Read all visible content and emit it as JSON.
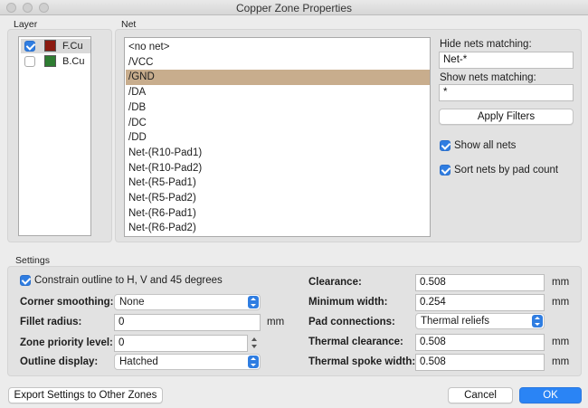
{
  "window": {
    "title": "Copper Zone Properties"
  },
  "layer": {
    "heading": "Layer",
    "items": [
      {
        "label": "F.Cu",
        "checked": true,
        "color": "#8b1a10"
      },
      {
        "label": "B.Cu",
        "checked": false,
        "color": "#2e7d32"
      }
    ]
  },
  "net": {
    "heading": "Net",
    "items": [
      "<no net>",
      "/VCC",
      "/GND",
      "/DA",
      "/DB",
      "/DC",
      "/DD",
      "Net-(R10-Pad1)",
      "Net-(R10-Pad2)",
      "Net-(R5-Pad1)",
      "Net-(R5-Pad2)",
      "Net-(R6-Pad1)",
      "Net-(R6-Pad2)"
    ],
    "selected": "/GND"
  },
  "filters": {
    "hide_label": "Hide nets matching:",
    "hide_value": "Net-*",
    "show_label": "Show nets matching:",
    "show_value": "*",
    "apply_label": "Apply Filters",
    "show_all_label": "Show all nets",
    "sort_label": "Sort nets by pad count"
  },
  "settings": {
    "heading": "Settings",
    "constrain_label": "Constrain outline to H, V and 45 degrees",
    "corner_smoothing_label": "Corner smoothing:",
    "corner_smoothing_value": "None",
    "fillet_radius_label": "Fillet radius:",
    "fillet_radius_value": "0",
    "fillet_radius_unit": "mm",
    "priority_label": "Zone priority level:",
    "priority_value": "0",
    "outline_display_label": "Outline display:",
    "outline_display_value": "Hatched",
    "clearance_label": "Clearance:",
    "clearance_value": "0.508",
    "clearance_unit": "mm",
    "min_width_label": "Minimum width:",
    "min_width_value": "0.254",
    "min_width_unit": "mm",
    "pad_connections_label": "Pad connections:",
    "pad_connections_value": "Thermal reliefs",
    "thermal_clearance_label": "Thermal clearance:",
    "thermal_clearance_value": "0.508",
    "thermal_clearance_unit": "mm",
    "spoke_width_label": "Thermal spoke width:",
    "spoke_width_value": "0.508",
    "spoke_width_unit": "mm"
  },
  "footer": {
    "export_label": "Export Settings to Other Zones",
    "cancel_label": "Cancel",
    "ok_label": "OK"
  },
  "colors": {
    "accent": "#2f7de1",
    "selection": "#c8ad8d"
  }
}
